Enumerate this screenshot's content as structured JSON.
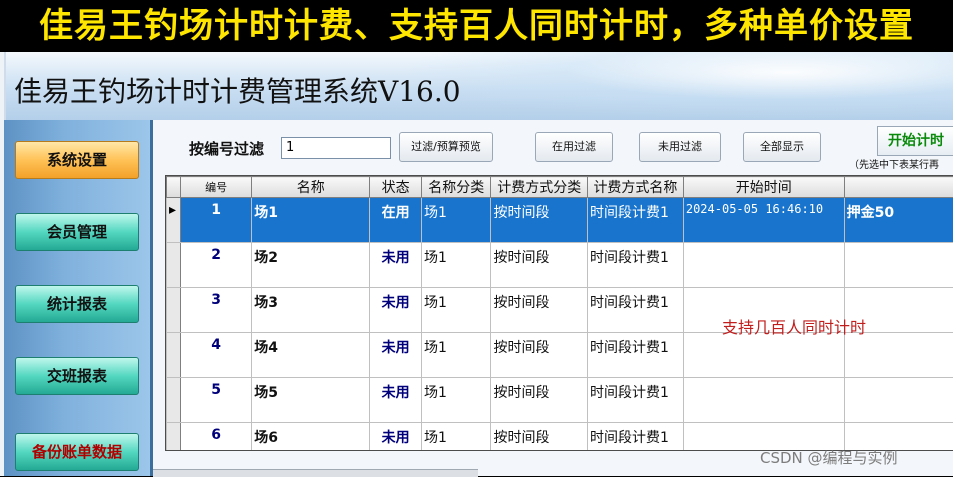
{
  "banner": {
    "text": "佳易王钓场计时计费、支持百人同时计时，多种单价设置"
  },
  "window": {
    "title": "佳易王钓场计时计费管理系统V16.0"
  },
  "sidebar": {
    "items": [
      {
        "label": "系统设置"
      },
      {
        "label": "会员管理"
      },
      {
        "label": "统计报表"
      },
      {
        "label": "交班报表"
      },
      {
        "label": "备份账单数据"
      }
    ]
  },
  "toolbar": {
    "filter_label": "按编号过滤",
    "filter_value": "1",
    "buttons": [
      "过滤/预算预览",
      "在用过滤",
      "未用过滤",
      "全部显示"
    ],
    "start_label": "开始计时",
    "hint": "（先选中下表某行再"
  },
  "table": {
    "headers": [
      "编号",
      "名称",
      "状态",
      "名称分类",
      "计费方式分类",
      "计费方式名称",
      "开始时间",
      ""
    ],
    "rows": [
      [
        "1",
        "场1",
        "在用",
        "场1",
        "按时间段",
        "时间段计费1",
        "2024-05-05 16:46:10",
        "押金50"
      ],
      [
        "2",
        "场2",
        "未用",
        "场1",
        "按时间段",
        "时间段计费1",
        "",
        ""
      ],
      [
        "3",
        "场3",
        "未用",
        "场1",
        "按时间段",
        "时间段计费1",
        "",
        ""
      ],
      [
        "4",
        "场4",
        "未用",
        "场1",
        "按时间段",
        "时间段计费1",
        "",
        ""
      ],
      [
        "5",
        "场5",
        "未用",
        "场1",
        "按时间段",
        "时间段计费1",
        "",
        ""
      ],
      [
        "6",
        "场6",
        "未用",
        "场1",
        "按时间段",
        "时间段计费1",
        "",
        ""
      ]
    ],
    "selected_row": 0,
    "note": "支持几百人同时计时"
  },
  "watermark": "CSDN @编程与实例",
  "colors": {
    "banner_text": "#ffe600",
    "selection": "#1874cd",
    "start_button": "#0a8a0a",
    "note": "#c21d1d"
  }
}
